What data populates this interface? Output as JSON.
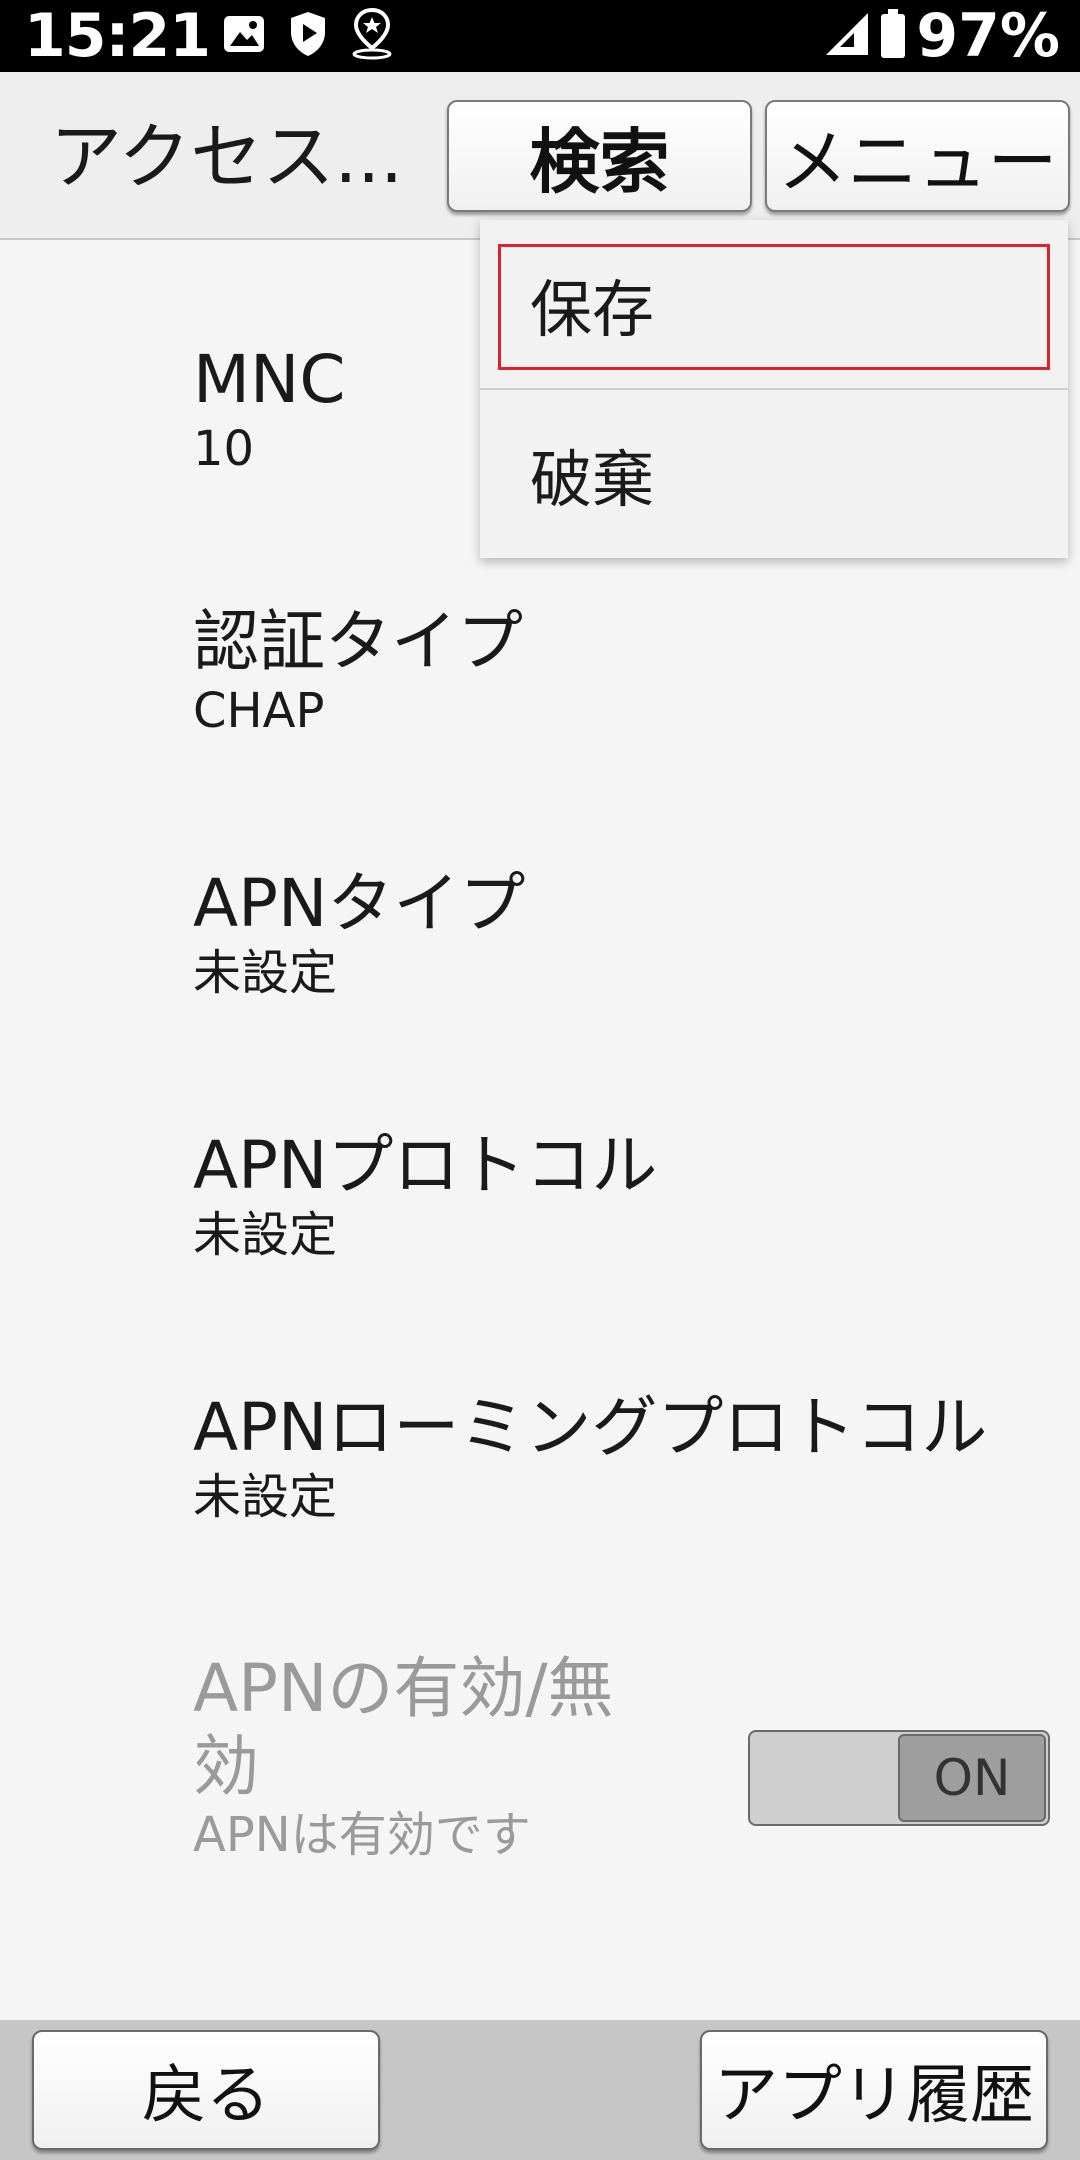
{
  "status_bar": {
    "time": "15:21",
    "icons_left": [
      "image-icon",
      "shield-icon",
      "location-pin-icon"
    ],
    "icons_right": [
      "signal-icon",
      "battery-icon"
    ],
    "battery_percent": "97%"
  },
  "app_bar": {
    "title": "アクセス...",
    "search_label": "検索",
    "menu_label": "メニュー"
  },
  "preferences": [
    {
      "title": "MNC",
      "summary": "10"
    },
    {
      "title": "認証タイプ",
      "summary": "CHAP"
    },
    {
      "title": "APNタイプ",
      "summary": "未設定"
    },
    {
      "title": "APNプロトコル",
      "summary": "未設定"
    },
    {
      "title": "APNローミングプロトコル",
      "summary": "未設定"
    },
    {
      "title": "APNの有効/無効",
      "summary": "APNは有効です",
      "enabled": false,
      "toggle_label": "ON",
      "toggle_state": "on"
    }
  ],
  "menu": {
    "items": [
      {
        "label": "保存",
        "focused": true
      },
      {
        "label": "破棄",
        "focused": false
      }
    ]
  },
  "bottom_bar": {
    "back_label": "戻る",
    "history_label": "アプリ履歴"
  },
  "colors": {
    "focus_ring": "#e0202a",
    "status_bar_bg": "#000000",
    "disabled_text": "#9a9a9a"
  }
}
